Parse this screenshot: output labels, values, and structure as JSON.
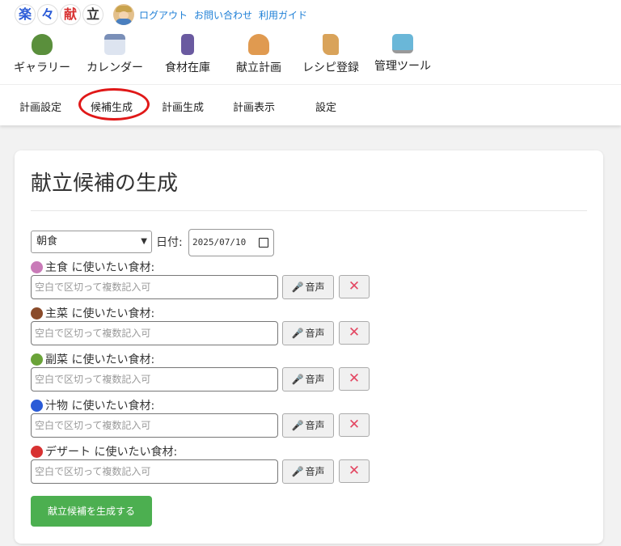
{
  "logo": {
    "chars": [
      "楽",
      "々",
      "献",
      "立"
    ],
    "colors": [
      "#2a5bd7",
      "#2a5bd7",
      "#d83232",
      "#333333"
    ]
  },
  "account": {
    "links": [
      "ログアウト",
      "お問い合わせ",
      "利用ガイド"
    ]
  },
  "menu": [
    {
      "label": "ギャラリー",
      "icon": "salad-icon",
      "color": "#5a8f3c"
    },
    {
      "label": "カレンダー",
      "icon": "calendar-icon",
      "color": "#7a8fb8"
    },
    {
      "label": "食材在庫",
      "icon": "cabinet-icon",
      "color": "#6a5aa0"
    },
    {
      "label": "献立計画",
      "icon": "chef-icon",
      "color": "#e09a50"
    },
    {
      "label": "レシピ登録",
      "icon": "scroll-icon",
      "color": "#d9a35a"
    },
    {
      "label": "管理ツール",
      "icon": "computer-icon",
      "color": "#6ab7d8"
    }
  ],
  "subnav": [
    "計画設定",
    "候補生成",
    "計画生成",
    "計画表示",
    "設定"
  ],
  "page_title": "献立候補の生成",
  "meal_select": {
    "value": "朝食"
  },
  "date": {
    "label": "日付:",
    "value": "2025/07/10"
  },
  "groups": [
    {
      "label": "主食 に使いたい食材:",
      "icon": "rice-icon",
      "color": "#c97bb8",
      "placeholder": "空白で区切って複数記入可"
    },
    {
      "label": "主菜 に使いたい食材:",
      "icon": "meat-icon",
      "color": "#8a4b2a",
      "placeholder": "空白で区切って複数記入可"
    },
    {
      "label": "副菜 に使いたい食材:",
      "icon": "broccoli-icon",
      "color": "#6aa338",
      "placeholder": "空白で区切って複数記入可"
    },
    {
      "label": "汁物 に使いたい食材:",
      "icon": "soup-icon",
      "color": "#2a5bd7",
      "placeholder": "空白で区切って複数記入可"
    },
    {
      "label": "デザート に使いたい食材:",
      "icon": "apple-icon",
      "color": "#d83232",
      "placeholder": "空白で区切って複数記入可"
    }
  ],
  "voice_label": "音声",
  "clear_symbol": "✕",
  "generate_label": "献立候補を生成する"
}
